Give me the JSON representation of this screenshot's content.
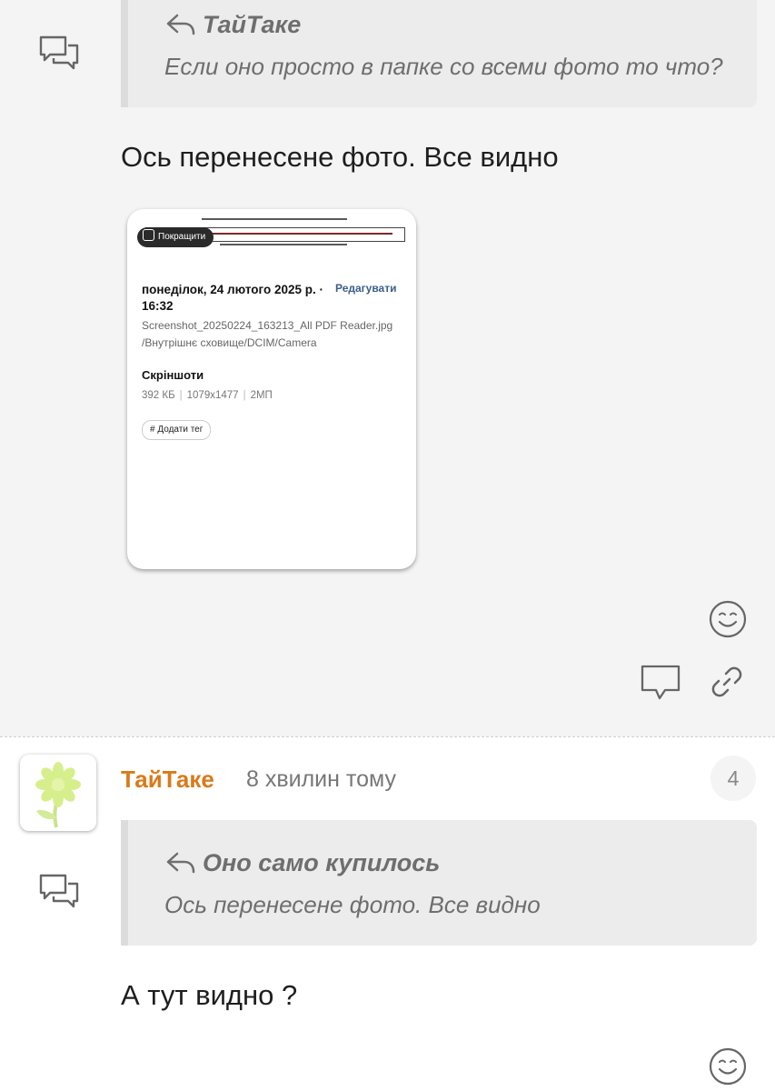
{
  "post1": {
    "quote": {
      "author": "ТайТаке",
      "text": "Если оно просто в папке со всеми фото то что?"
    },
    "message": "Ось перенесене фото. Все видно",
    "attachment": {
      "enhance_label": "Покращити",
      "date": "понеділок, 24 лютого 2025 р. · 16:32",
      "edit_label": "Редагувати",
      "filename": "Screenshot_20250224_163213_All PDF Reader.jpg",
      "path": "/Внутрішнє сховище/DCIM/Camera",
      "album": "Скріншоти",
      "size": "392 КБ",
      "resolution": "1079x1477",
      "megapixels": "2МП",
      "tag_label": "# Додати тег"
    },
    "icons": [
      "smile-icon",
      "comment-icon",
      "link-icon",
      "chat-icon"
    ]
  },
  "post2": {
    "author": "ТайТаке",
    "time": "8 хвилин тому",
    "number": "4",
    "quote": {
      "author": "Оно само купилось",
      "text": "Ось перенесене фото. Все видно"
    },
    "message": "А тут видно ?",
    "icons": [
      "avatar-flower",
      "smile-icon",
      "chat-icon"
    ]
  },
  "colors": {
    "accent": "#d97a1a",
    "quote_bg": "#ececec",
    "post_bg": "#f4f4f4",
    "text": "#1e1e1e",
    "muted": "#6e6e6e"
  }
}
